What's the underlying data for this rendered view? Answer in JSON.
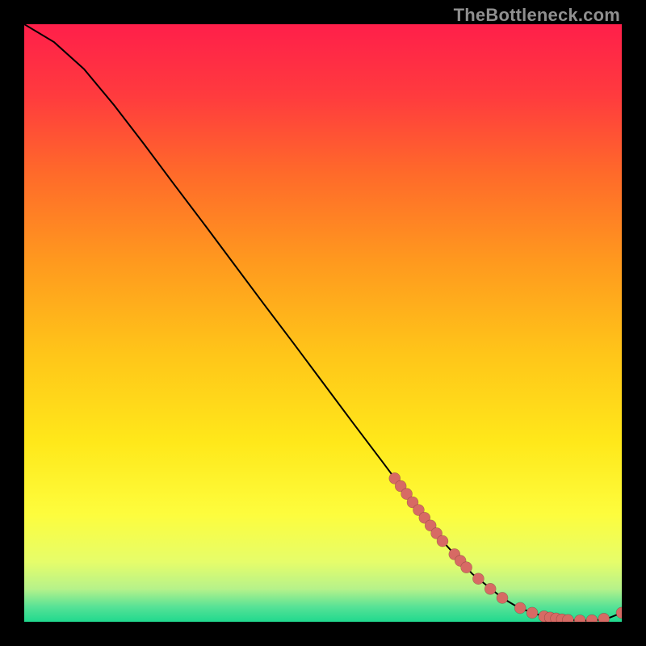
{
  "watermark": "TheBottleneck.com",
  "gradient_stops": [
    {
      "offset": 0.0,
      "color": "#ff1f4a"
    },
    {
      "offset": 0.12,
      "color": "#ff3b3e"
    },
    {
      "offset": 0.25,
      "color": "#ff6a2a"
    },
    {
      "offset": 0.4,
      "color": "#ff9a1e"
    },
    {
      "offset": 0.55,
      "color": "#ffc519"
    },
    {
      "offset": 0.7,
      "color": "#ffe81a"
    },
    {
      "offset": 0.82,
      "color": "#fdfd3d"
    },
    {
      "offset": 0.9,
      "color": "#e6fd6a"
    },
    {
      "offset": 0.945,
      "color": "#b6f28a"
    },
    {
      "offset": 0.975,
      "color": "#57e296"
    },
    {
      "offset": 1.0,
      "color": "#20d98e"
    }
  ],
  "chart_data": {
    "type": "line",
    "title": "",
    "xlabel": "",
    "ylabel": "",
    "xlim": [
      0,
      100
    ],
    "ylim": [
      0,
      100
    ],
    "series": [
      {
        "name": "curve",
        "x": [
          0,
          5,
          10,
          15,
          20,
          25,
          30,
          35,
          40,
          45,
          50,
          55,
          60,
          65,
          70,
          75,
          80,
          82,
          84,
          86,
          88,
          90,
          92,
          94,
          96,
          98,
          100
        ],
        "y": [
          100,
          97,
          92.5,
          86.5,
          80,
          73.3,
          66.7,
          60,
          53.3,
          46.7,
          40,
          33.3,
          26.7,
          20,
          13.5,
          8,
          4,
          2.8,
          1.9,
          1.2,
          0.7,
          0.4,
          0.25,
          0.2,
          0.3,
          0.7,
          1.5
        ]
      }
    ],
    "points": {
      "name": "markers",
      "x": [
        62,
        63,
        64,
        65,
        66,
        67,
        68,
        69,
        70,
        72,
        73,
        74,
        76,
        78,
        80,
        83,
        85,
        87,
        88,
        89,
        90,
        91,
        93,
        95,
        97,
        100
      ],
      "y": [
        24,
        22.7,
        21.4,
        20,
        18.7,
        17.4,
        16.1,
        14.8,
        13.5,
        11.3,
        10.2,
        9.1,
        7.2,
        5.5,
        4,
        2.3,
        1.5,
        0.9,
        0.7,
        0.55,
        0.4,
        0.3,
        0.22,
        0.25,
        0.5,
        1.5
      ]
    }
  }
}
